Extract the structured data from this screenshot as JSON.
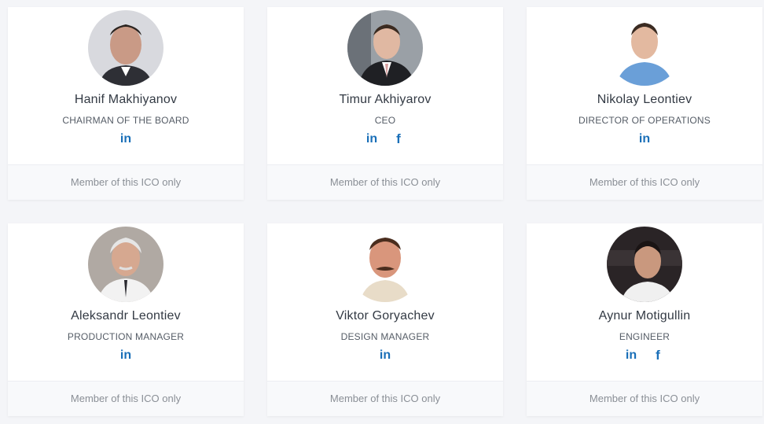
{
  "members": [
    {
      "name": "Hanif Makhiyanov",
      "role": "CHAIRMAN OF THE BOARD",
      "footer": "Member of this ICO only",
      "linkedin": "in",
      "facebook": ""
    },
    {
      "name": "Timur Akhiyarov",
      "role": "CEO",
      "footer": "Member of this ICO only",
      "linkedin": "in",
      "facebook": "f"
    },
    {
      "name": "Nikolay Leontiev",
      "role": "DIRECTOR OF OPERATIONS",
      "footer": "Member of this ICO only",
      "linkedin": "in",
      "facebook": ""
    },
    {
      "name": "Aleksandr Leontiev",
      "role": "PRODUCTION MANAGER",
      "footer": "Member of this ICO only",
      "linkedin": "in",
      "facebook": ""
    },
    {
      "name": "Viktor Goryachev",
      "role": "DESIGN MANAGER",
      "footer": "Member of this ICO only",
      "linkedin": "in",
      "facebook": ""
    },
    {
      "name": "Aynur Motigullin",
      "role": "ENGINEER",
      "footer": "Member of this ICO only",
      "linkedin": "in",
      "facebook": "f"
    }
  ],
  "colors": {
    "link": "#1a6fb8",
    "background": "#f4f5f8"
  }
}
